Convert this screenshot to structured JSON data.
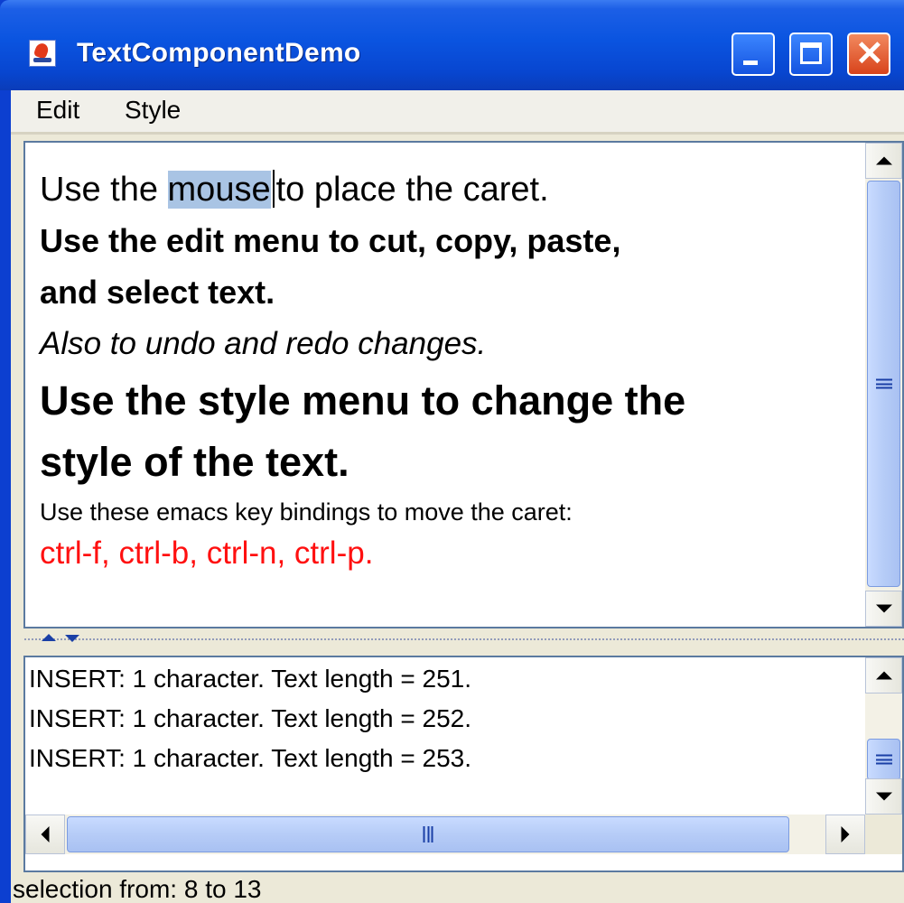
{
  "window": {
    "title": "TextComponentDemo",
    "icon": "java-cup-icon",
    "controls": [
      "minimize-icon",
      "maximize-icon",
      "close-icon"
    ],
    "close_glyph": "✕"
  },
  "menubar": {
    "items": [
      {
        "label": "Edit"
      },
      {
        "label": "Style"
      }
    ]
  },
  "document": {
    "line1": {
      "before": "Use the ",
      "selected": "mouse",
      "after": "to place the caret."
    },
    "line2": "Use the edit menu to cut, copy, paste,",
    "line3": "and select text.",
    "line4": "Also to undo and redo changes.",
    "line5": "Use the style menu to change the",
    "line6": "style of the text.",
    "line7": "Use these emacs key bindings to move the caret:",
    "line8": "ctrl-f, ctrl-b, ctrl-n, ctrl-p.",
    "colors": {
      "selection": "#a9c4e4",
      "red_text": "#ff1010"
    }
  },
  "log": {
    "lines": [
      "INSERT: 1 character.  Text length = 251.",
      "INSERT: 1 character.  Text length = 252.",
      "INSERT: 1 character.  Text length = 253."
    ]
  },
  "status": {
    "text": "selection from: 8 to 13"
  },
  "accent": {
    "title_bar": "#0a54e0",
    "close_button": "#d8431b"
  }
}
